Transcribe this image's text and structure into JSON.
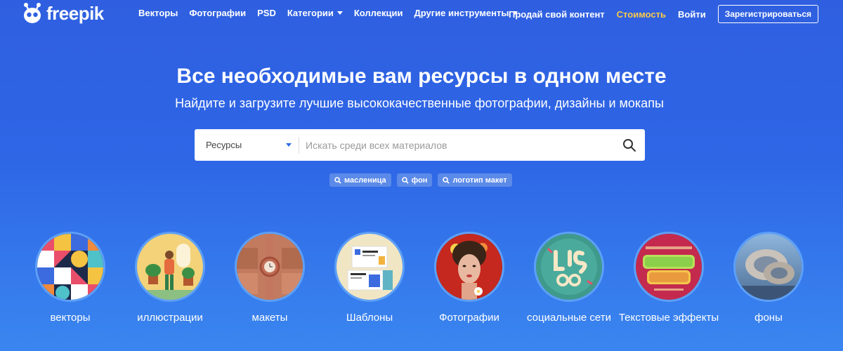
{
  "header": {
    "brand": "freepik",
    "nav": [
      {
        "label": "Векторы",
        "dropdown": false
      },
      {
        "label": "Фотографии",
        "dropdown": false
      },
      {
        "label": "PSD",
        "dropdown": false
      },
      {
        "label": "Категории",
        "dropdown": true
      },
      {
        "label": "Коллекции",
        "dropdown": false
      },
      {
        "label": "Другие инструменты",
        "dropdown": true
      }
    ],
    "sell": "Продай свой контент",
    "pricing": "Стоимость",
    "login": "Войти",
    "register": "Зарегистрироваться"
  },
  "hero": {
    "title": "Все необходимые вам ресурсы в одном месте",
    "subtitle": "Найдите и загрузите лучшие высококачественные фотографии, дизайны и мокапы"
  },
  "search": {
    "category": "Ресурсы",
    "placeholder": "Искать среди всех материалов",
    "tags": [
      "масленица",
      "фон",
      "логотип макет"
    ]
  },
  "categories": [
    {
      "label": "векторы",
      "icon": "vectors-thumbnail"
    },
    {
      "label": "иллюстрации",
      "icon": "illustrations-thumbnail"
    },
    {
      "label": "макеты",
      "icon": "mockups-thumbnail"
    },
    {
      "label": "Шаблоны",
      "icon": "templates-thumbnail"
    },
    {
      "label": "Фотографии",
      "icon": "photos-thumbnail"
    },
    {
      "label": "социальные сети",
      "icon": "social-media-thumbnail"
    },
    {
      "label": "Текстовые эффекты",
      "icon": "text-effects-thumbnail"
    },
    {
      "label": "фоны",
      "icon": "backgrounds-thumbnail"
    }
  ],
  "colors": {
    "accent": "#2d6ae3",
    "pricing": "#f8c94a"
  }
}
